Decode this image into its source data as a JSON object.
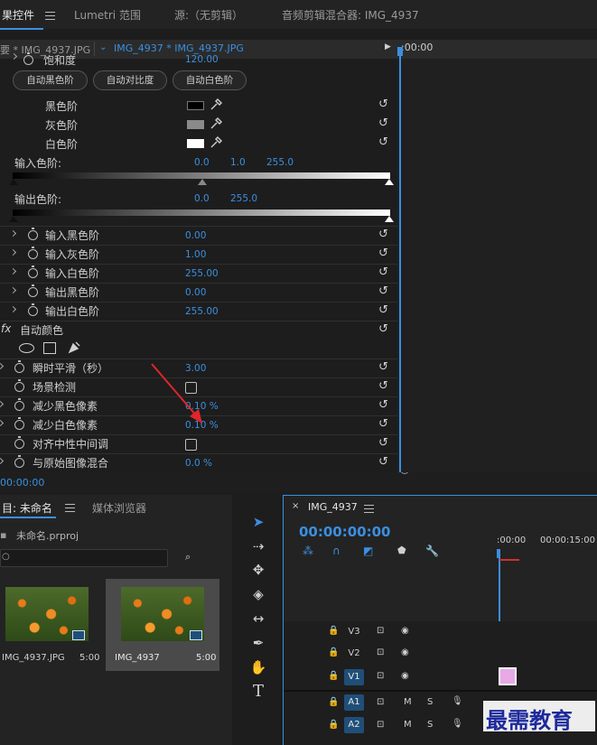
{
  "top_tabs": {
    "effect_controls": "果控件",
    "lumetri": "Lumetri 范围",
    "source": "源:（无剪辑）",
    "audio_mixer": "音频剪辑混合器: IMG_4937"
  },
  "clip_bar": {
    "master": "要 * IMG_4937.JPG",
    "clip": "IMG_4937 * IMG_4937.JPG",
    "timecode": ":00:00"
  },
  "effect": {
    "partial_row_value": "120.00",
    "partial_row_label": "饱和度",
    "auto_buttons": [
      "自动黑色阶",
      "自动对比度",
      "自动白色阶"
    ],
    "levels": [
      {
        "label": "黑色阶",
        "color": "#000000"
      },
      {
        "label": "灰色阶",
        "color": "#8a8a8a"
      },
      {
        "label": "白色阶",
        "color": "#ffffff"
      }
    ],
    "input_levels": {
      "label": "输入色阶:",
      "v1": "0.0",
      "v2": "1.0",
      "v3": "255.0"
    },
    "output_levels": {
      "label": "输出色阶:",
      "v1": "0.0",
      "v2": "255.0"
    },
    "params": [
      {
        "label": "输入黑色阶",
        "value": "0.00"
      },
      {
        "label": "输入灰色阶",
        "value": "1.00"
      },
      {
        "label": "输入白色阶",
        "value": "255.00"
      },
      {
        "label": "输出黑色阶",
        "value": "0.00"
      },
      {
        "label": "输出白色阶",
        "value": "255.00"
      }
    ],
    "fx_label": "自动颜色",
    "auto_color": [
      {
        "label": "瞬时平滑（秒）",
        "value": "3.00"
      },
      {
        "label": "场景检测",
        "value": ""
      },
      {
        "label": "减少黑色像素",
        "value": "0.10 %"
      },
      {
        "label": "减少白色像素",
        "value": "0.10 %"
      },
      {
        "label": "对齐中性中间调",
        "value": ""
      },
      {
        "label": "与原始图像混合",
        "value": "0.0 %"
      }
    ],
    "bottom_timecode": "00:00:00"
  },
  "project": {
    "tab": "目: 未命名",
    "media_browser": "媒体浏览器",
    "project_file": "未命名.prproj",
    "items": [
      {
        "name": "IMG_4937.JPG",
        "duration": "5:00"
      },
      {
        "name": "IMG_4937",
        "duration": "5:00"
      }
    ]
  },
  "sequence": {
    "tab": "IMG_4937",
    "timecode": "00:00:00:00",
    "ruler": [
      ":00:00",
      "00:00:15:00"
    ],
    "video_tracks": [
      "V3",
      "V2",
      "V1"
    ],
    "audio_tracks": [
      "A1",
      "A2"
    ],
    "audio_m": "M",
    "audio_s": "S"
  },
  "watermark": "最需教育",
  "accent": "#3b8fe0"
}
